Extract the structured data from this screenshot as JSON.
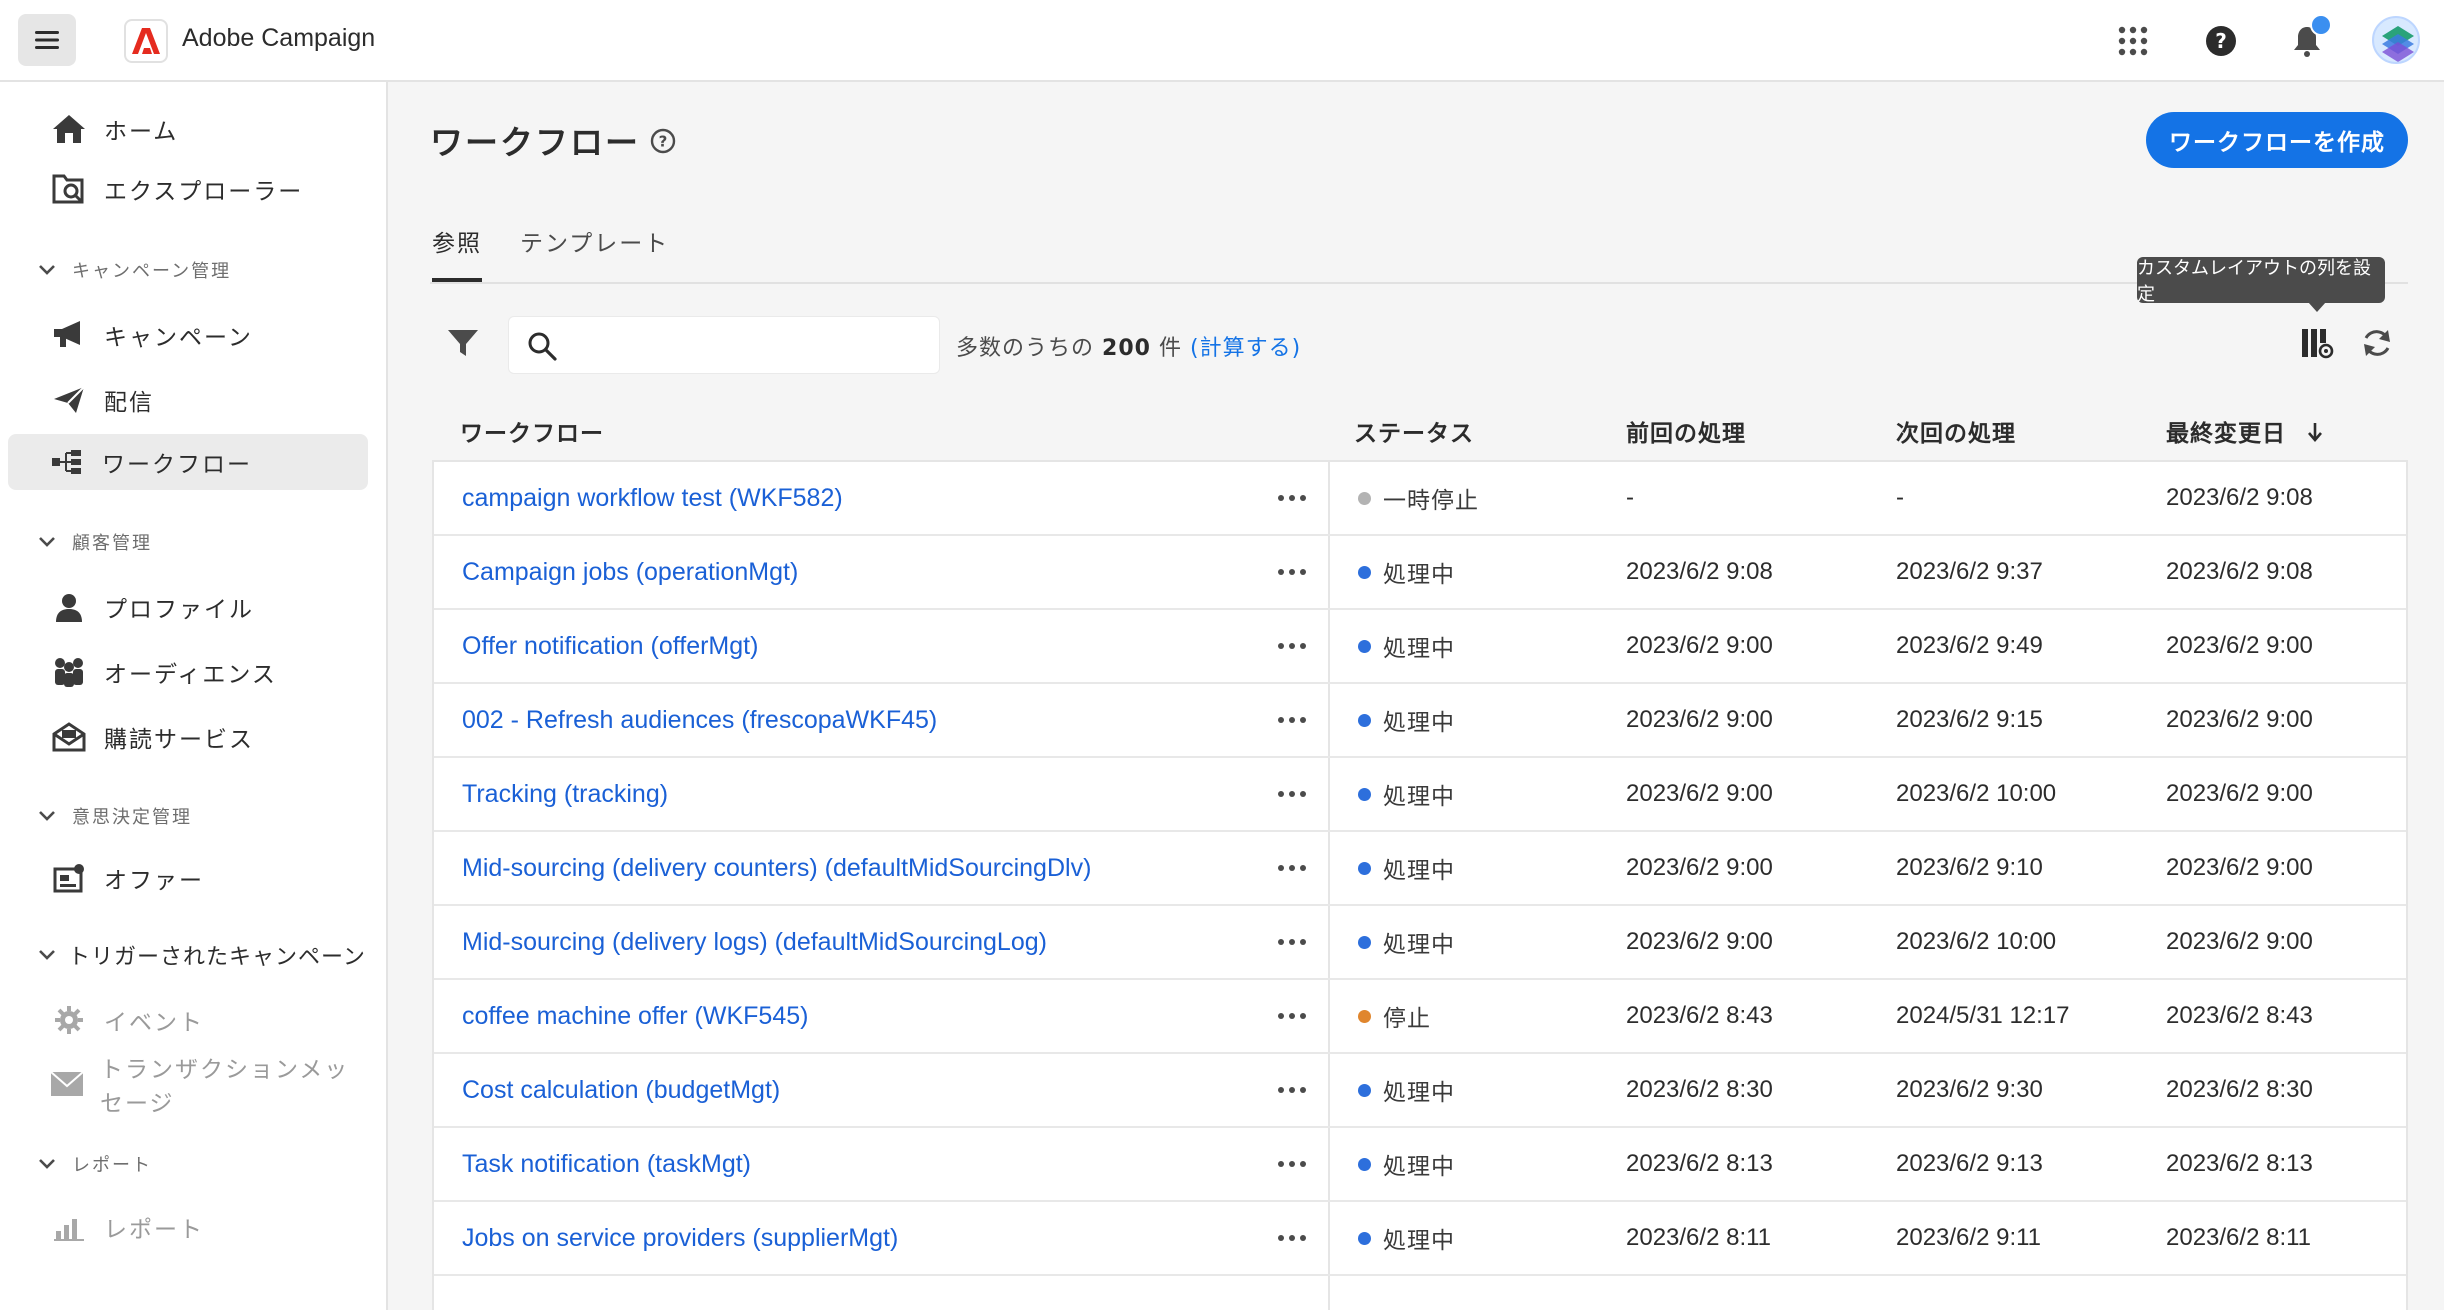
{
  "header": {
    "app_name": "Adobe Campaign"
  },
  "sidebar": {
    "items": [
      {
        "label": "ホーム",
        "icon": "home-icon"
      },
      {
        "label": "エクスプローラー",
        "icon": "explorer-icon"
      },
      {
        "label": "キャンペーン",
        "icon": "megaphone-icon"
      },
      {
        "label": "配信",
        "icon": "send-icon"
      },
      {
        "label": "ワークフロー",
        "icon": "workflow-icon"
      },
      {
        "label": "プロファイル",
        "icon": "user-icon"
      },
      {
        "label": "オーディエンス",
        "icon": "audience-icon"
      },
      {
        "label": "購読サービス",
        "icon": "subscription-icon"
      },
      {
        "label": "オファー",
        "icon": "offer-icon"
      },
      {
        "label": "イベント",
        "icon": "gear-icon"
      },
      {
        "label": "トランザクションメッセージ",
        "icon": "mail-icon"
      },
      {
        "label": "レポート",
        "icon": "bar-chart-icon"
      }
    ],
    "sections": [
      {
        "label": "キャンペーン管理"
      },
      {
        "label": "顧客管理"
      },
      {
        "label": "意思決定管理"
      },
      {
        "label": "トリガーされたキャンペーン"
      },
      {
        "label": "レポート"
      }
    ],
    "selected": "ワークフロー"
  },
  "main": {
    "title": "ワークフロー",
    "create_button": "ワークフローを作成",
    "tabs": [
      {
        "label": "参照"
      },
      {
        "label": "テンプレート"
      }
    ],
    "tooltip": "カスタムレイアウトの列を設定",
    "search": {
      "value": "",
      "placeholder": ""
    },
    "count": {
      "prefix": "多数のうちの",
      "number": "200",
      "suffix": "件",
      "open": "(",
      "link": "計算する",
      "close": ")"
    },
    "columns": {
      "workflow": "ワークフロー",
      "status": "ステータス",
      "prev": "前回の処理",
      "next": "次回の処理",
      "modified": "最終変更日"
    }
  },
  "colors": {
    "accent": "#1473e6",
    "status_running": "#2d6fdc",
    "status_paused": "#b3b3b3",
    "status_stopped": "#e0862e"
  },
  "rows": [
    {
      "name": "campaign workflow test (WKF582)",
      "status": "一時停止",
      "status_kind": "paused",
      "prev": "-",
      "next": "-",
      "modified": "2023/6/2 9:08"
    },
    {
      "name": "Campaign jobs (operationMgt)",
      "status": "処理中",
      "status_kind": "running",
      "prev": "2023/6/2 9:08",
      "next": "2023/6/2 9:37",
      "modified": "2023/6/2 9:08"
    },
    {
      "name": "Offer notification (offerMgt)",
      "status": "処理中",
      "status_kind": "running",
      "prev": "2023/6/2 9:00",
      "next": "2023/6/2 9:49",
      "modified": "2023/6/2 9:00"
    },
    {
      "name": "002 - Refresh audiences (frescopaWKF45)",
      "status": "処理中",
      "status_kind": "running",
      "prev": "2023/6/2 9:00",
      "next": "2023/6/2 9:15",
      "modified": "2023/6/2 9:00"
    },
    {
      "name": "Tracking (tracking)",
      "status": "処理中",
      "status_kind": "running",
      "prev": "2023/6/2 9:00",
      "next": "2023/6/2 10:00",
      "modified": "2023/6/2 9:00"
    },
    {
      "name": "Mid-sourcing (delivery counters) (defaultMidSourcingDlv)",
      "status": "処理中",
      "status_kind": "running",
      "prev": "2023/6/2 9:00",
      "next": "2023/6/2 9:10",
      "modified": "2023/6/2 9:00"
    },
    {
      "name": "Mid-sourcing (delivery logs) (defaultMidSourcingLog)",
      "status": "処理中",
      "status_kind": "running",
      "prev": "2023/6/2 9:00",
      "next": "2023/6/2 10:00",
      "modified": "2023/6/2 9:00"
    },
    {
      "name": "coffee machine offer (WKF545)",
      "status": "停止",
      "status_kind": "stopped",
      "prev": "2023/6/2 8:43",
      "next": "2024/5/31 12:17",
      "modified": "2023/6/2 8:43"
    },
    {
      "name": "Cost calculation (budgetMgt)",
      "status": "処理中",
      "status_kind": "running",
      "prev": "2023/6/2 8:30",
      "next": "2023/6/2 9:30",
      "modified": "2023/6/2 8:30"
    },
    {
      "name": "Task notification (taskMgt)",
      "status": "処理中",
      "status_kind": "running",
      "prev": "2023/6/2 8:13",
      "next": "2023/6/2 9:13",
      "modified": "2023/6/2 8:13"
    },
    {
      "name": "Jobs on service providers (supplierMgt)",
      "status": "処理中",
      "status_kind": "running",
      "prev": "2023/6/2 8:11",
      "next": "2023/6/2 9:11",
      "modified": "2023/6/2 8:11"
    }
  ]
}
